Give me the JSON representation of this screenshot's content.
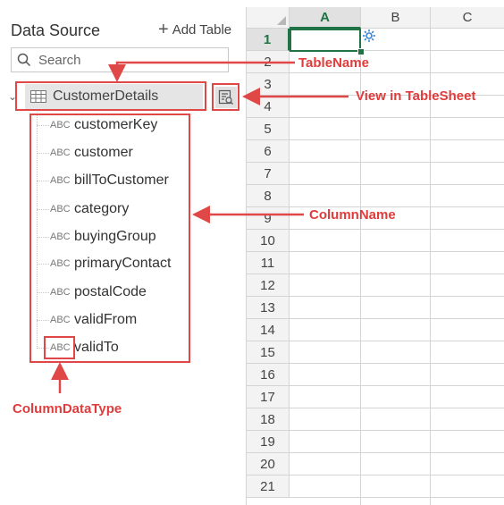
{
  "panel": {
    "title": "Data Source",
    "add_table_label": "Add Table",
    "search_placeholder": "Search"
  },
  "table": {
    "name": "CustomerDetails",
    "columns": [
      {
        "type": "ABC",
        "name": "customerKey"
      },
      {
        "type": "ABC",
        "name": "customer"
      },
      {
        "type": "ABC",
        "name": "billToCustomer"
      },
      {
        "type": "ABC",
        "name": "category"
      },
      {
        "type": "ABC",
        "name": "buyingGroup"
      },
      {
        "type": "ABC",
        "name": "primaryContact"
      },
      {
        "type": "ABC",
        "name": "postalCode"
      },
      {
        "type": "ABC",
        "name": "validFrom"
      },
      {
        "type": "ABC",
        "name": "validTo"
      }
    ]
  },
  "sheet": {
    "columns": [
      "A",
      "B",
      "C"
    ],
    "rows": [
      "1",
      "2",
      "3",
      "4",
      "5",
      "6",
      "7",
      "8",
      "9",
      "10",
      "11",
      "12",
      "13",
      "14",
      "15",
      "16",
      "17",
      "18",
      "19",
      "20",
      "21"
    ],
    "active_cell": "A1"
  },
  "annotations": {
    "table_name": "TableName",
    "view_in_tablesheet": "View in TableSheet",
    "column_name": "ColumnName",
    "column_data_type": "ColumnDataType"
  },
  "colors": {
    "accent_green": "#217346",
    "annotation_red": "#e03c3c"
  }
}
